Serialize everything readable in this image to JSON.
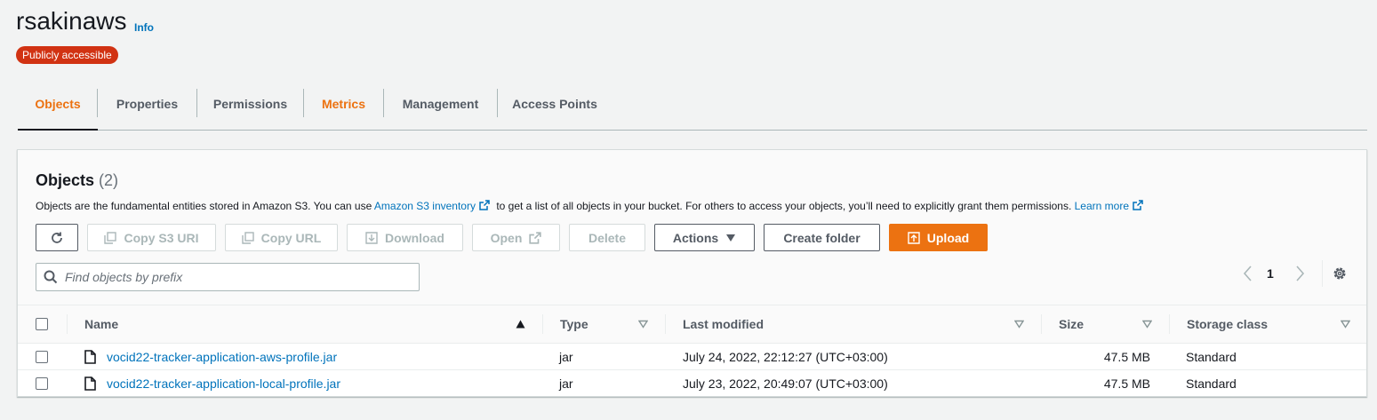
{
  "header": {
    "bucket_name": "rsakinaws",
    "info_label": "Info",
    "access_badge": "Publicly accessible"
  },
  "tabs": [
    {
      "label": "Objects",
      "active": true
    },
    {
      "label": "Properties",
      "active": false
    },
    {
      "label": "Permissions",
      "active": false
    },
    {
      "label": "Metrics",
      "active": false
    },
    {
      "label": "Management",
      "active": false
    },
    {
      "label": "Access Points",
      "active": false
    }
  ],
  "objects_panel": {
    "title": "Objects",
    "count": "(2)",
    "description_part1": "Objects are the fundamental entities stored in Amazon S3. You can use ",
    "inventory_link": "Amazon S3 inventory",
    "description_part2": " to get a list of all objects in your bucket. For others to access your objects, you’ll need to explicitly grant them permissions. ",
    "learn_more_link": "Learn more"
  },
  "toolbar": {
    "refresh_icon": "refresh-icon",
    "copy_s3_uri": "Copy S3 URI",
    "copy_url": "Copy URL",
    "download": "Download",
    "open": "Open",
    "delete": "Delete",
    "actions": "Actions",
    "create_folder": "Create folder",
    "upload": "Upload"
  },
  "search": {
    "placeholder": "Find objects by prefix",
    "value": ""
  },
  "pagination": {
    "current_page": "1"
  },
  "table": {
    "columns": [
      "Name",
      "Type",
      "Last modified",
      "Size",
      "Storage class"
    ],
    "rows": [
      {
        "name": "vocid22-tracker-application-aws-profile.jar",
        "type": "jar",
        "last_modified": "July 24, 2022, 22:12:27 (UTC+03:00)",
        "size": "47.5 MB",
        "storage_class": "Standard"
      },
      {
        "name": "vocid22-tracker-application-local-profile.jar",
        "type": "jar",
        "last_modified": "July 23, 2022, 20:49:07 (UTC+03:00)",
        "size": "47.5 MB",
        "storage_class": "Standard"
      }
    ]
  },
  "colors": {
    "accent_orange": "#ec7211",
    "link_blue": "#0073bb",
    "badge_red": "#d13212",
    "text_dark": "#16191f",
    "text_muted": "#545b64"
  }
}
